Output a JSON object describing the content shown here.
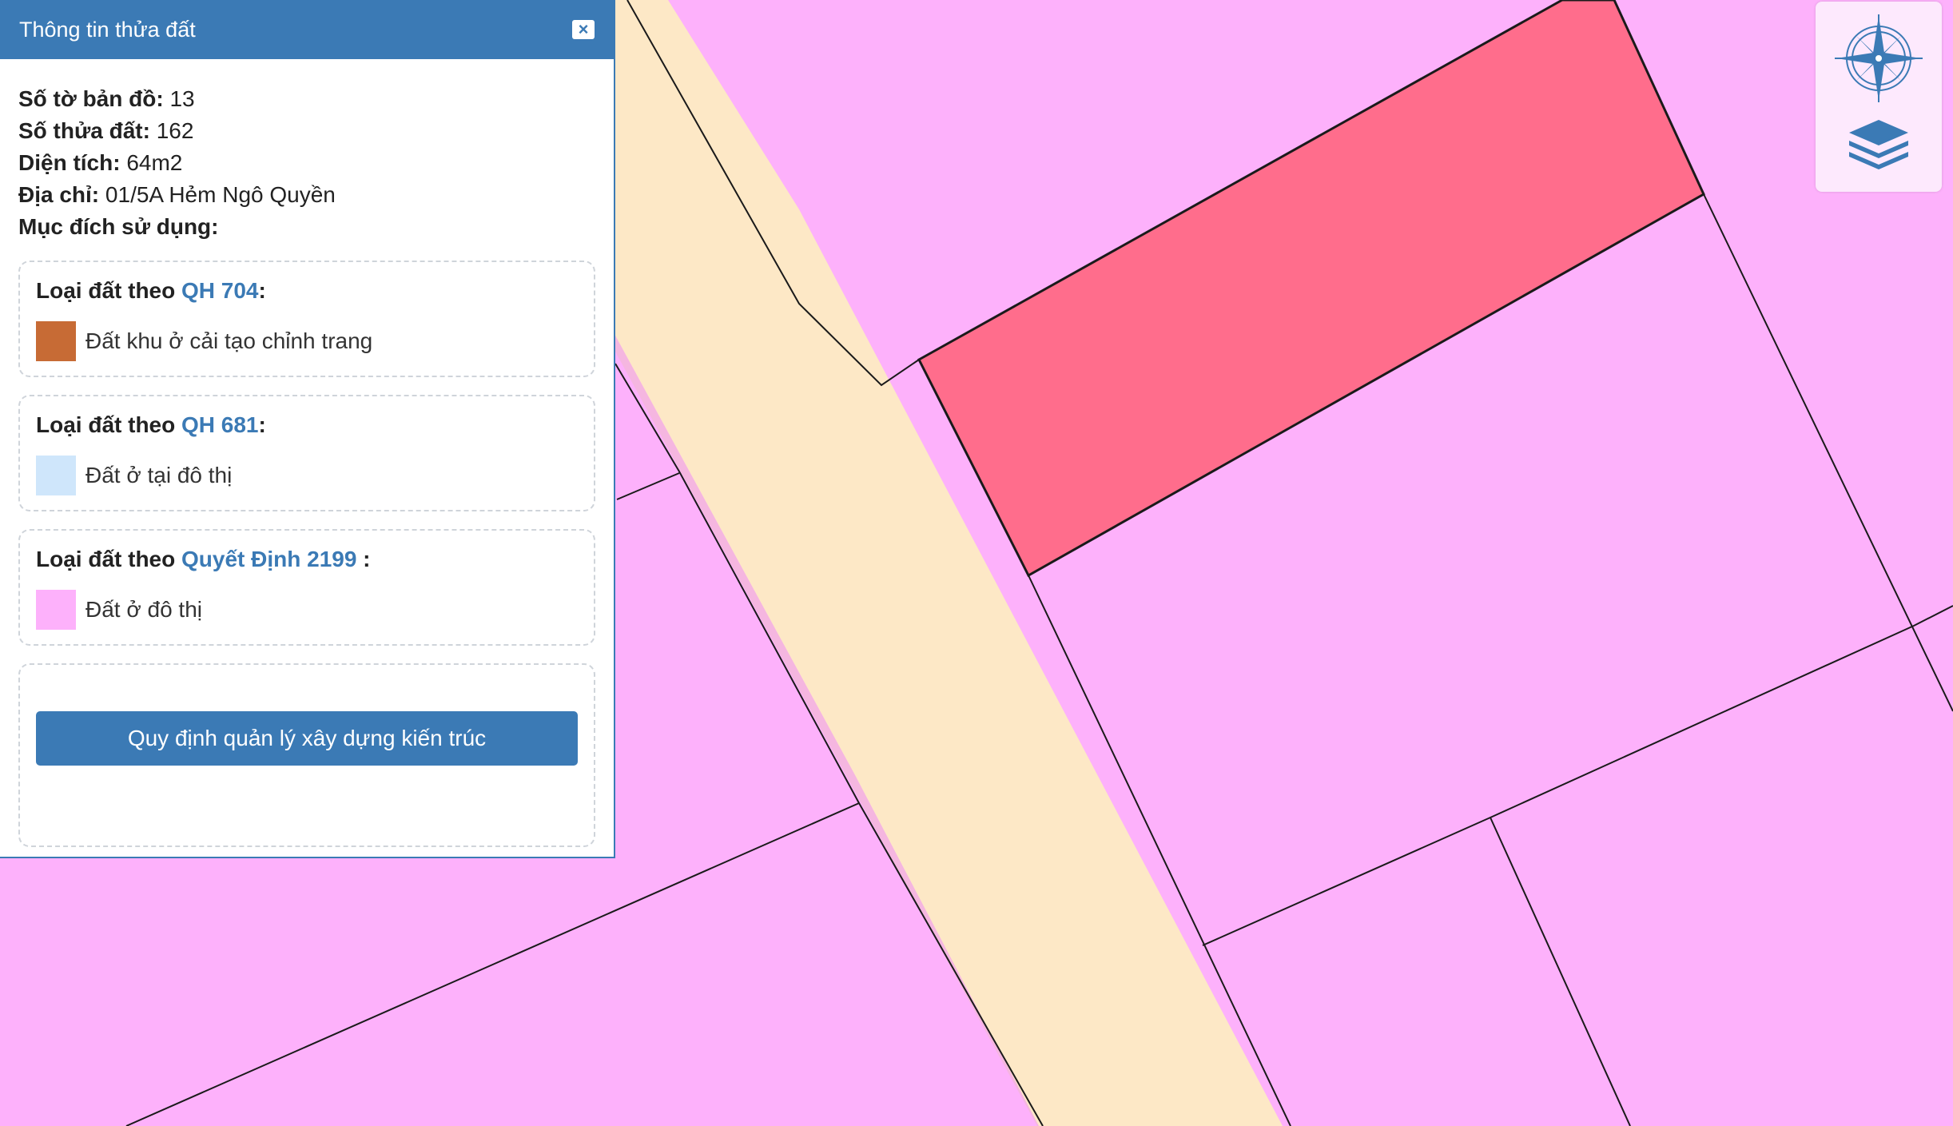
{
  "panel": {
    "title": "Thông tin thửa đất",
    "close_icon": "close-icon",
    "fields": [
      {
        "label": "Số tờ bản đồ:",
        "value": " 13"
      },
      {
        "label": "Số thửa đất:",
        "value": " 162"
      },
      {
        "label": "Diện tích:",
        "value": " 64m2"
      },
      {
        "label": "Địa chỉ:",
        "value": " 01/5A Hẻm Ngô Quyền"
      },
      {
        "label": "Mục đích sử dụng:",
        "value": ""
      }
    ],
    "plans": [
      {
        "prefix": "Loại đất theo ",
        "name": "QH 704",
        "suffix": ":",
        "swatch_color": "#c76b35",
        "land_type": "Đất khu ở cải tạo chỉnh trang"
      },
      {
        "prefix": "Loại đất theo ",
        "name": "QH 681",
        "suffix": ":",
        "swatch_color": "#cfe6fb",
        "land_type": "Đất ở tại đô thị"
      },
      {
        "prefix": "Loại đất theo ",
        "name": "Quyết Định 2199",
        "suffix": " :",
        "swatch_color": "#fdb1fb",
        "land_type": "Đất ở đô thị"
      }
    ],
    "regulation_button": "Quy định quản lý xây dựng kiến trúc"
  },
  "map": {
    "colors": {
      "residential": "#fdb1fb",
      "road": "#fde8c6",
      "selected_parcel": "#ff6d8c",
      "boundary": "#1a1a1a"
    }
  },
  "controls": {
    "compass_icon": "compass-icon",
    "layers_icon": "layers-icon"
  }
}
